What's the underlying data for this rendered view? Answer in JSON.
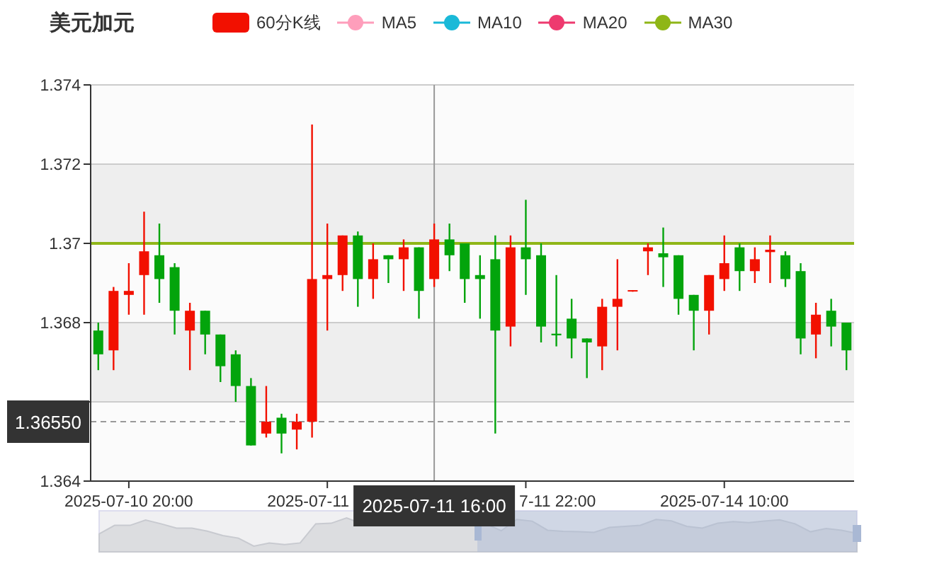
{
  "title": "美元加元",
  "legend": [
    {
      "kind": "candle",
      "color": "#f21000"
    },
    {
      "label": "MA5",
      "kind": "line",
      "color": "#fe9ebb"
    },
    {
      "label": "MA10",
      "kind": "line",
      "color": "#1ab9d8"
    },
    {
      "label": "MA20",
      "kind": "line",
      "color": "#ee3a6f"
    },
    {
      "label": "MA30",
      "kind": "line",
      "color": "#8fb617"
    }
  ],
  "chart_data": {
    "type": "candlestick",
    "grid": true,
    "ylim": [
      1.364,
      1.374
    ],
    "yticks": [
      1.364,
      1.368,
      1.37,
      1.372,
      1.374
    ],
    "categories": [
      null,
      null,
      "2025-07-10 20:00",
      null,
      null,
      null,
      null,
      null,
      null,
      null,
      null,
      null,
      null,
      null,
      null,
      null,
      null,
      null,
      null,
      null,
      null,
      null,
      null,
      null,
      null,
      null,
      null,
      null,
      null,
      null,
      null,
      null,
      null,
      null,
      null,
      null,
      null,
      null,
      null,
      null,
      null,
      "2025-07-14 10:00",
      null,
      null,
      null,
      null,
      null,
      null,
      null,
      null
    ],
    "series": [
      {
        "name": "60分K线",
        "color": "#f21000",
        "ohlc": [
          null,
          [
            1.3673,
            1.3689,
            1.3668,
            1.3688
          ],
          [
            1.3687,
            1.3695,
            1.3682,
            1.3688
          ],
          [
            1.3692,
            1.3708,
            1.3682,
            1.3698
          ],
          null,
          null,
          [
            1.3678,
            1.3685,
            1.3668,
            1.3683
          ],
          null,
          null,
          null,
          null,
          [
            1.3652,
            1.3664,
            1.3651,
            1.3655
          ],
          null,
          [
            1.3653,
            1.3657,
            1.3648,
            1.3655
          ],
          [
            1.3655,
            1.373,
            1.3651,
            1.3691
          ],
          [
            1.3691,
            1.3705,
            1.3678,
            1.3692
          ],
          [
            1.3692,
            1.3702,
            1.3688,
            1.3702
          ],
          null,
          [
            1.3691,
            1.37,
            1.3686,
            1.3696
          ],
          null,
          [
            1.3696,
            1.3701,
            1.3688,
            1.3699
          ],
          null,
          [
            1.3691,
            1.3705,
            1.3689,
            1.3701
          ],
          null,
          null,
          null,
          null,
          [
            1.3679,
            1.3702,
            1.3674,
            1.3699
          ],
          null,
          null,
          null,
          null,
          null,
          [
            1.3674,
            1.3686,
            1.3668,
            1.3684
          ],
          [
            1.3684,
            1.3696,
            1.3673,
            1.3686
          ],
          [
            1.3688,
            1.36882,
            1.36878,
            1.36882
          ],
          [
            1.3698,
            1.37,
            1.3692,
            1.3699
          ],
          null,
          null,
          null,
          [
            1.3683,
            1.3692,
            1.3677,
            1.3692
          ],
          [
            1.3691,
            1.3702,
            1.3688,
            1.3695
          ],
          null,
          [
            1.3693,
            1.3699,
            1.369,
            1.3696
          ],
          [
            1.36978,
            1.3702,
            1.369,
            1.36984
          ],
          null,
          null,
          [
            1.3677,
            1.3685,
            1.3671,
            1.3682
          ],
          null,
          null
        ]
      },
      {
        "color": "#03a40c",
        "ohlc": [
          [
            1.3678,
            1.368,
            1.3668,
            1.3672
          ],
          null,
          null,
          null,
          [
            1.3697,
            1.3705,
            1.3685,
            1.3691
          ],
          [
            1.3694,
            1.3695,
            1.3677,
            1.3683
          ],
          null,
          [
            1.3683,
            1.3683,
            1.3672,
            1.3677
          ],
          [
            1.3677,
            1.3677,
            1.3665,
            1.3669
          ],
          [
            1.3672,
            1.3673,
            1.366,
            1.3664
          ],
          [
            1.3664,
            1.3666,
            1.3649,
            1.3649
          ],
          null,
          [
            1.3656,
            1.3657,
            1.3647,
            1.3652
          ],
          null,
          null,
          null,
          null,
          [
            1.3702,
            1.3703,
            1.3684,
            1.3691
          ],
          null,
          [
            1.3697,
            1.3697,
            1.369,
            1.3696
          ],
          null,
          [
            1.3699,
            1.3699,
            1.3681,
            1.3688
          ],
          null,
          [
            1.3701,
            1.3705,
            1.3693,
            1.3697
          ],
          [
            1.37,
            1.37,
            1.3685,
            1.3691
          ],
          [
            1.3692,
            1.3697,
            1.3681,
            1.3691
          ],
          [
            1.3696,
            1.3702,
            1.3652,
            1.3678
          ],
          null,
          [
            1.3699,
            1.3711,
            1.3687,
            1.3696
          ],
          [
            1.3697,
            1.37,
            1.3675,
            1.3679
          ],
          [
            1.36772,
            1.3692,
            1.3674,
            1.36768
          ],
          [
            1.3681,
            1.3686,
            1.3671,
            1.3676
          ],
          [
            1.3676,
            1.3676,
            1.3666,
            1.3675
          ],
          null,
          null,
          null,
          null,
          [
            1.36975,
            1.3704,
            1.3689,
            1.36965
          ],
          [
            1.3697,
            1.3697,
            1.3682,
            1.3686
          ],
          [
            1.3687,
            1.3687,
            1.3673,
            1.3683
          ],
          null,
          null,
          [
            1.3699,
            1.37,
            1.3688,
            1.3693
          ],
          null,
          null,
          [
            1.3697,
            1.3698,
            1.3689,
            1.3691
          ],
          [
            1.3693,
            1.3695,
            1.3672,
            1.3676
          ],
          null,
          [
            1.3683,
            1.3686,
            1.3674,
            1.3679
          ],
          [
            1.368,
            1.368,
            1.3668,
            1.3673
          ]
        ]
      }
    ],
    "bands": [
      {
        "axis": "y",
        "from": 1.37,
        "to": 1.372,
        "color": "#eeeeee"
      },
      {
        "axis": "y",
        "from": 1.366,
        "to": 1.368,
        "color": "#eeeeee"
      }
    ],
    "ref_lines": [
      {
        "axis": "y",
        "value": 1.37,
        "color": "#8fb617"
      },
      {
        "axis": "y",
        "value": 1.3655,
        "color": "#999999",
        "label": "1.36550"
      }
    ]
  },
  "crosshair": {
    "x_label": "2025-07-11 16:00"
  },
  "x_axis_fragments": [
    "2025-07-11",
    "7-11 22:00"
  ]
}
